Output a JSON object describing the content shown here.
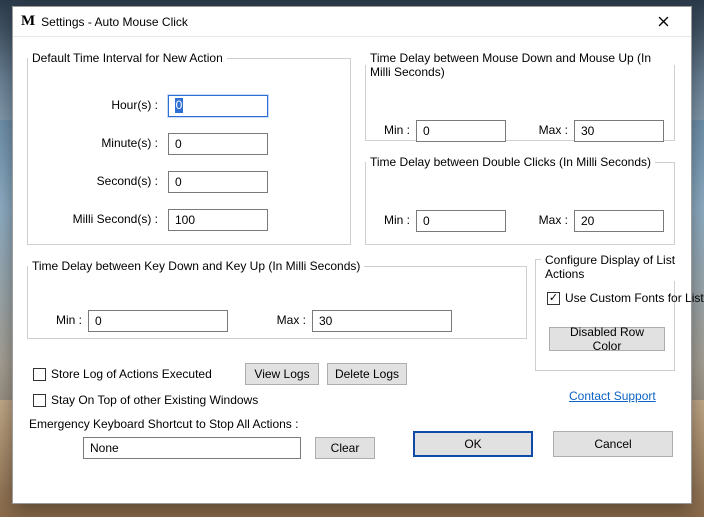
{
  "window": {
    "title": "Settings - Auto Mouse Click"
  },
  "groups": {
    "default_interval": {
      "title": "Default Time Interval for New Action",
      "hours_label": "Hour(s) :",
      "hours_value": "0",
      "minutes_label": "Minute(s) :",
      "minutes_value": "0",
      "seconds_label": "Second(s) :",
      "seconds_value": "0",
      "millis_label": "Milli Second(s) :",
      "millis_value": "100"
    },
    "mouse_delay": {
      "title": "Time Delay between Mouse Down and Mouse Up (In Milli Seconds)",
      "min_label": "Min :",
      "min_value": "0",
      "max_label": "Max :",
      "max_value": "30"
    },
    "dblclick_delay": {
      "title": "Time Delay between Double Clicks (In Milli Seconds)",
      "min_label": "Min :",
      "min_value": "0",
      "max_label": "Max :",
      "max_value": "20"
    },
    "key_delay": {
      "title": "Time Delay between Key Down and Key Up (In Milli Seconds)",
      "min_label": "Min :",
      "min_value": "0",
      "max_label": "Max :",
      "max_value": "30"
    },
    "list_display": {
      "title": "Configure Display of List Actions",
      "checkbox_label": "Use Custom Fonts for List of Actions",
      "checkbox_checked": true,
      "button_label": "Disabled Row Color"
    }
  },
  "options": {
    "store_log_label": "Store Log of Actions Executed",
    "store_log_checked": false,
    "view_logs_label": "View Logs",
    "delete_logs_label": "Delete Logs",
    "stay_on_top_label": "Stay On Top of other Existing Windows",
    "stay_on_top_checked": false,
    "contact_support_label": "Contact Support",
    "emergency_label": "Emergency Keyboard Shortcut to Stop All Actions :",
    "emergency_value": "None",
    "clear_label": "Clear"
  },
  "buttons": {
    "ok": "OK",
    "cancel": "Cancel"
  }
}
